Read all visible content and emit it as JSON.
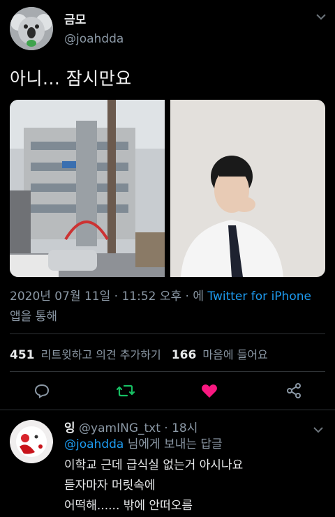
{
  "tweet": {
    "author_name": "금모",
    "author_handle": "@joahdda",
    "text": "아니... 잠시만요",
    "timestamp": "2020년 07월 11일 · 11:52 오후 · 에",
    "source_app": "Twitter for iPhone",
    "source_suffix": "앱을 통해"
  },
  "stats": {
    "retweets_count": "451",
    "retweets_label": "리트윗하고 의견 추가하기",
    "likes_count": "166",
    "likes_label": "마음에 들어요"
  },
  "actions": [
    "reply-icon",
    "retweet-icon",
    "like-icon",
    "share-icon"
  ],
  "colors": {
    "accent": "#1d9bf0",
    "retweet": "#17bf63",
    "like": "#f91880"
  },
  "reply": {
    "author_name": "잉",
    "author_handle": "@yamING_txt",
    "time": "· 18시",
    "mention": "@joahdda",
    "mention_suffix": "님에게 보내는 답글",
    "lines": [
      "이학교 근데 급식실 없는거 아시나요",
      "듣자마자 머릿속에",
      "어떡해...... 밖에 안떠오름"
    ]
  }
}
